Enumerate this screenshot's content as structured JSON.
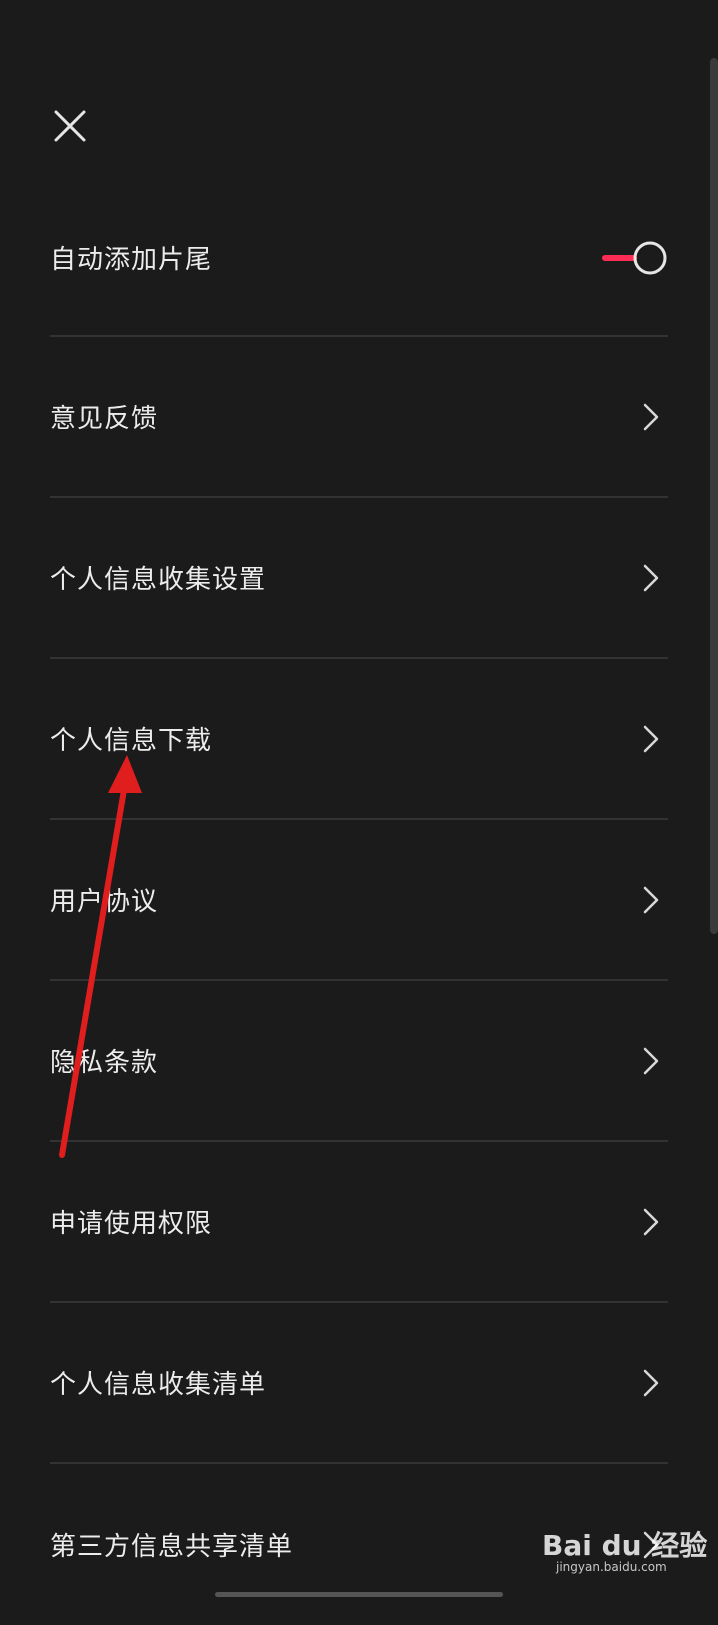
{
  "header": {
    "close_icon": "close-icon"
  },
  "menu": {
    "items": [
      {
        "label": "自动添加片尾",
        "control": "toggle",
        "toggle_on": true
      },
      {
        "label": "意见反馈",
        "control": "chevron"
      },
      {
        "label": "个人信息收集设置",
        "control": "chevron"
      },
      {
        "label": "个人信息下载",
        "control": "chevron"
      },
      {
        "label": "用户协议",
        "control": "chevron"
      },
      {
        "label": "隐私条款",
        "control": "chevron"
      },
      {
        "label": "申请使用权限",
        "control": "chevron"
      },
      {
        "label": "个人信息收集清单",
        "control": "chevron"
      },
      {
        "label": "第三方信息共享清单",
        "control": "chevron"
      }
    ]
  },
  "colors": {
    "background": "#1b1b1b",
    "toggle_accent": "#ff2d55",
    "annotation_arrow": "#e01e1e"
  },
  "watermark": {
    "logo": "Bai du 经验",
    "url": "jingyan.baidu.com"
  }
}
